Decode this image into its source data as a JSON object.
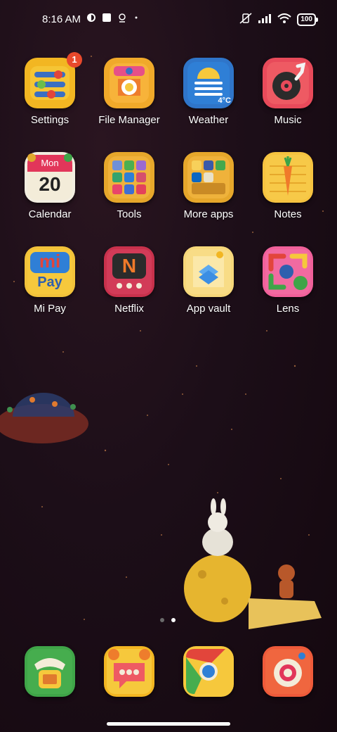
{
  "status": {
    "time": "8:16 AM",
    "battery": "100"
  },
  "apps": [
    {
      "label": "Settings",
      "badge": "1"
    },
    {
      "label": "File Manager"
    },
    {
      "label": "Weather",
      "temp": "4°C"
    },
    {
      "label": "Music"
    },
    {
      "label": "Calendar",
      "day": "Mon",
      "date": "20"
    },
    {
      "label": "Tools"
    },
    {
      "label": "More apps"
    },
    {
      "label": "Notes"
    },
    {
      "label": "Mi Pay",
      "logo_text": "mi",
      "sub_text": "Pay"
    },
    {
      "label": "Netflix",
      "logo_text": "N"
    },
    {
      "label": "App vault"
    },
    {
      "label": "Lens"
    }
  ],
  "dock": [
    {
      "name": "phone"
    },
    {
      "name": "messages"
    },
    {
      "name": "chrome"
    },
    {
      "name": "camera"
    }
  ],
  "pages": {
    "count": 2,
    "active": 2
  }
}
